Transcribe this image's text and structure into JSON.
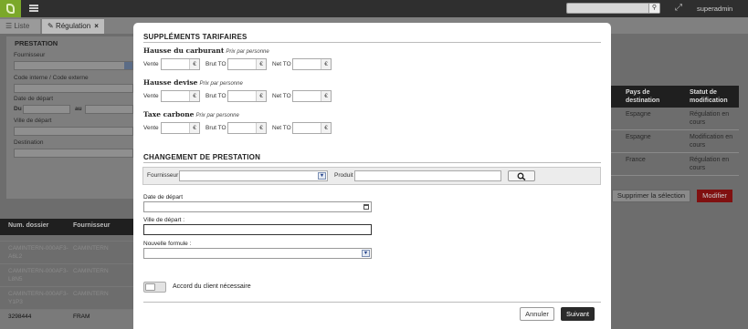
{
  "topbar": {
    "user": "superadmin",
    "search_placeholder": ""
  },
  "tabs": [
    {
      "label": "Liste"
    },
    {
      "label": "Régulation",
      "close": "×"
    }
  ],
  "filter_panel": {
    "title": "PRESTATION",
    "fields": [
      "Fournisseur",
      "Code interne / Code externe",
      "Date de départ",
      "Ville de départ",
      "Destination"
    ],
    "date_from": "Du",
    "date_to": "au"
  },
  "background_table": {
    "headers": [
      "Num. dossier",
      "Fournisseur"
    ],
    "rows": [
      {
        "dossier": "CAMINTERN-000AF3-A6L2",
        "fournisseur": "CAMINTERN"
      },
      {
        "dossier": "CAMINTERN-000AF3-L8N5",
        "fournisseur": "CAMINTERN"
      },
      {
        "dossier": "CAMINTERN-000AF3-Y1P3",
        "fournisseur": "CAMINTERN"
      },
      {
        "dossier": "3298444",
        "fournisseur": "FRAM"
      }
    ]
  },
  "background_right": {
    "headers": [
      "Pays de destination",
      "Statut de modification"
    ],
    "rows": [
      {
        "pays": "Espagne",
        "statut": "Régulation en cours"
      },
      {
        "pays": "Espagne",
        "statut": "Modification en cours"
      },
      {
        "pays": "France",
        "statut": "Régulation en cours"
      }
    ],
    "btn_delete": "Supprimer la sélection",
    "btn_modify": "Modifier"
  },
  "modal": {
    "supplements_title": "SUPPLÉMENTS TARIFAIRES",
    "groups": [
      {
        "title": "Hausse du carburant",
        "note": "Prix par personne"
      },
      {
        "title": "Hausse devise",
        "note": "Prix par personne"
      },
      {
        "title": "Taxe carbone",
        "note": "Prix par personne"
      }
    ],
    "price_labels": {
      "vente": "Vente",
      "brut": "Brut TO",
      "net": "Net TO"
    },
    "currency": "€",
    "change_title": "CHANGEMENT DE PRESTATION",
    "search": {
      "fournisseur_label": "Fournisseur",
      "produit_label": "Produit"
    },
    "date_label": "Date de départ",
    "ville_label": "Ville de départ :",
    "formule_label": "Nouvelle formule :",
    "accord_label": "Accord du client nécessaire",
    "cancel": "Annuler",
    "next": "Suivant"
  },
  "colors": {
    "accent_green": "#7ba82a",
    "modify_red": "#a51616",
    "dark": "#2a2a2a"
  },
  "icons": [
    "logo-icon",
    "menu-icon",
    "search-icon",
    "expand-icon",
    "calendar-icon",
    "chevron-down-icon",
    "close-icon"
  ]
}
